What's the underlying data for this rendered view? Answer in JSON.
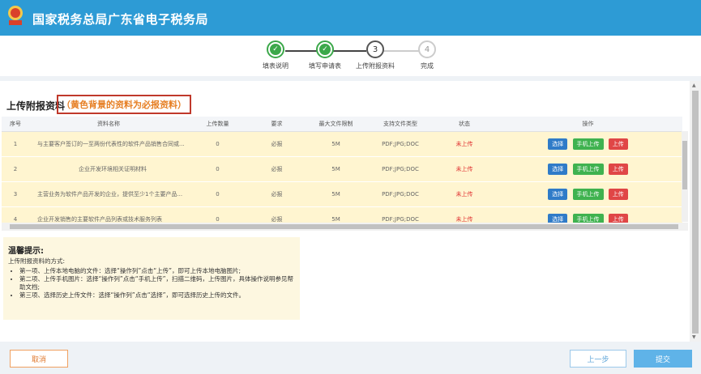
{
  "header": {
    "title": "国家税务总局广东省电子税务局"
  },
  "steps": [
    {
      "label": "填表说明",
      "status": "done",
      "number": ""
    },
    {
      "label": "填写申请表",
      "status": "done",
      "number": ""
    },
    {
      "label": "上传附报资料",
      "status": "current",
      "number": "3"
    },
    {
      "label": "完成",
      "status": "pending",
      "number": "4"
    }
  ],
  "section": {
    "title": "上传附报资料",
    "note": "（黄色背景的资料为必报资料）"
  },
  "table": {
    "headers": [
      "序号",
      "资料名称",
      "上传数量",
      "要求",
      "最大文件限制",
      "支持文件类型",
      "状态",
      "操作"
    ],
    "rows": [
      {
        "no": "1",
        "name": "与主要客户签订的一至两份代表性的软件产品销售合同或...",
        "count": "0",
        "req": "必报",
        "max": "5M",
        "types": "PDF;JPG;DOC",
        "status": "未上传"
      },
      {
        "no": "2",
        "name": "企业开发环境相关证明材料",
        "count": "0",
        "req": "必报",
        "max": "5M",
        "types": "PDF;JPG;DOC",
        "status": "未上传"
      },
      {
        "no": "3",
        "name": "主营业务为软件产品开发的企业，提供至少1个主要产品...",
        "count": "0",
        "req": "必报",
        "max": "5M",
        "types": "PDF;JPG;DOC",
        "status": "未上传"
      },
      {
        "no": "4",
        "name": "企业开发销售的主要软件产品列表或技术服务列表",
        "count": "0",
        "req": "必报",
        "max": "5M",
        "types": "PDF;JPG;DOC",
        "status": "未上传"
      }
    ],
    "actions": {
      "select": "选择",
      "mobile": "手机上传",
      "upload": "上传"
    }
  },
  "tips": {
    "title": "温馨提示:",
    "subtitle": "上传附报资料的方式:",
    "items": [
      "第一项、上传本地电脑的文件：选择“操作列”点击“上传”，即可上传本地电脑图片;",
      "第二项、上传手机图片：选择“操作列”点击“手机上传”，扫描二维码，上传图片，具体操作说明参见帮助文档;",
      "第三项、选择历史上传文件：选择“操作列”点击“选择”，即可选择历史上传的文件。"
    ]
  },
  "footer": {
    "cancel": "取消",
    "prev": "上一步",
    "submit": "提交"
  },
  "colors": {
    "header": "#2d9bd5",
    "required_row": "#fff5d0",
    "status_red": "#e03030",
    "note_border": "#c0392b"
  }
}
